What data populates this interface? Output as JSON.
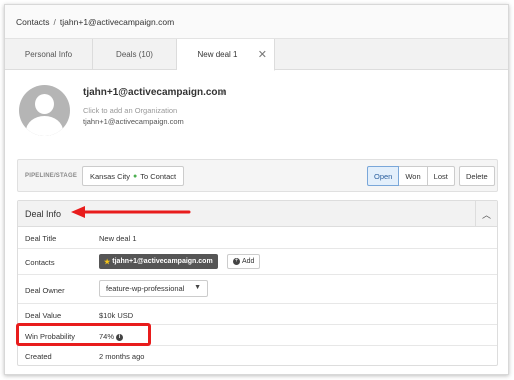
{
  "breadcrumb": {
    "root": "Contacts",
    "separator": "/",
    "current": "tjahn+1@activecampaign.com"
  },
  "tabs": [
    {
      "label": "Personal Info"
    },
    {
      "label": "Deals (10)"
    },
    {
      "label": "New deal 1",
      "close": "✕"
    }
  ],
  "contact": {
    "name": "tjahn+1@activecampaign.com",
    "org_placeholder": "Click to add an Organization",
    "email": "tjahn+1@activecampaign.com"
  },
  "pipeline": {
    "label": "PIPELINE/STAGE",
    "pipeline_name": "Kansas City",
    "stage_name": "To Contact",
    "status_buttons": {
      "open": "Open",
      "won": "Won",
      "lost": "Lost"
    },
    "active_status": "Open",
    "delete_label": "Delete"
  },
  "deal_info": {
    "title": "Deal Info",
    "collapse_icon": "chevron-up-icon",
    "rows": {
      "deal_title": {
        "label": "Deal Title",
        "value": "New deal 1"
      },
      "contacts": {
        "label": "Contacts",
        "chip": "tjahn+1@activecampaign.com",
        "add_label": "Add"
      },
      "deal_owner": {
        "label": "Deal Owner",
        "value": "feature-wp-professional"
      },
      "deal_value": {
        "label": "Deal Value",
        "value": "$10k USD"
      },
      "win_probability": {
        "label": "Win Probability",
        "value": "74%"
      },
      "created": {
        "label": "Created",
        "value": "2 months ago"
      }
    }
  },
  "colors": {
    "annotation": "#e81c1c",
    "open_active": "#e3effb",
    "stage_dot": "#4caf50"
  }
}
